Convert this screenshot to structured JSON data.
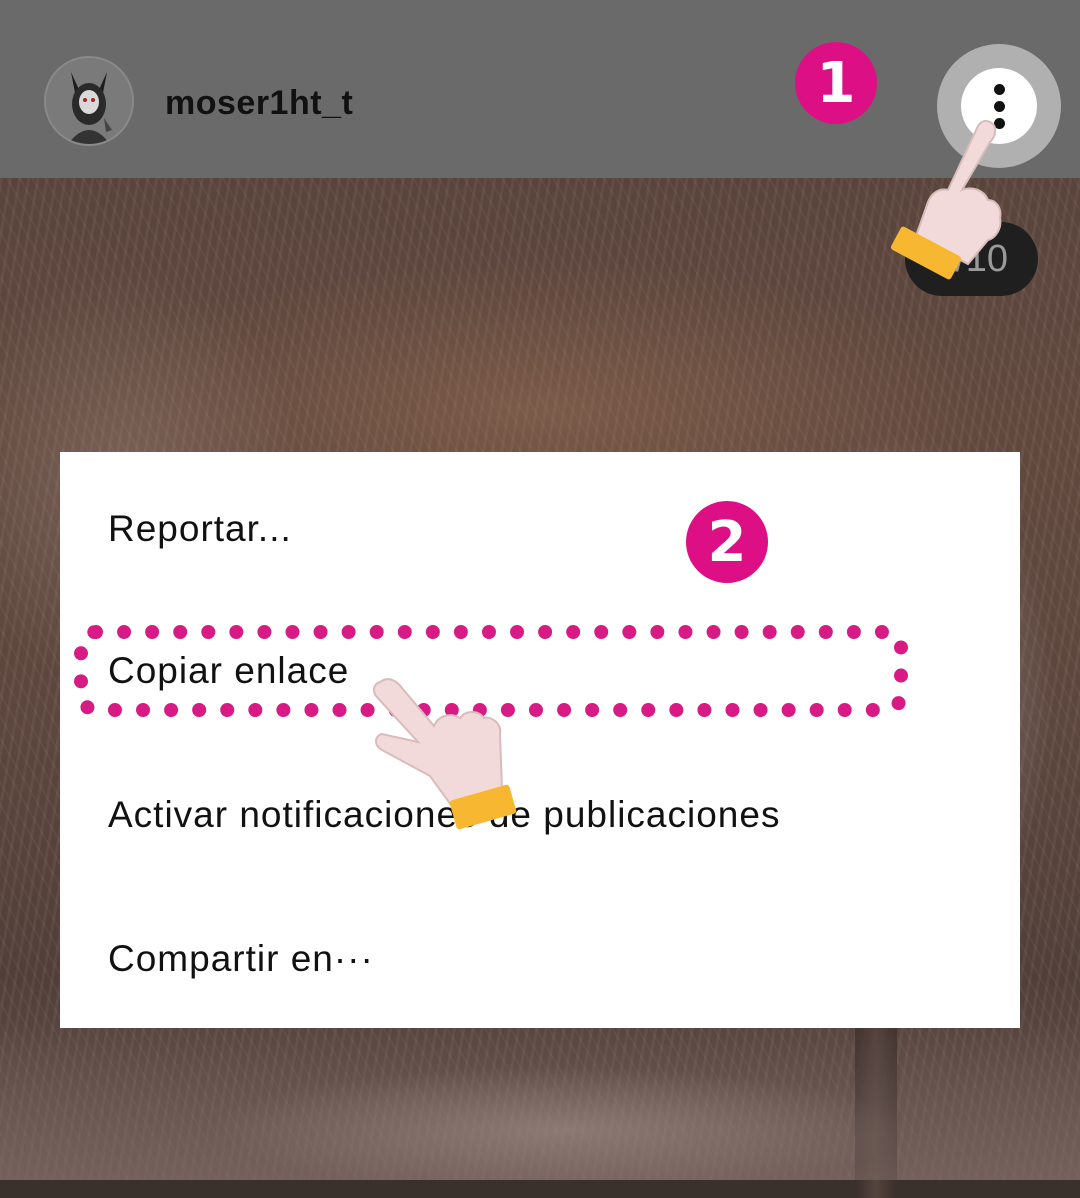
{
  "header": {
    "username": "moser1ht_t",
    "more_icon": "vertical-ellipsis-icon"
  },
  "counter": {
    "text": "/10"
  },
  "steps": {
    "step1": "1",
    "step2": "2"
  },
  "menu": {
    "items": [
      {
        "label": "Reportar..."
      },
      {
        "label": "Copiar enlace"
      },
      {
        "label": "Activar notificaciones de publicaciones"
      },
      {
        "label": "Compartir en···"
      }
    ]
  },
  "colors": {
    "accent": "#dd0f85",
    "header_bg": "#6a6a6a",
    "hand_cuff": "#f7b731"
  }
}
